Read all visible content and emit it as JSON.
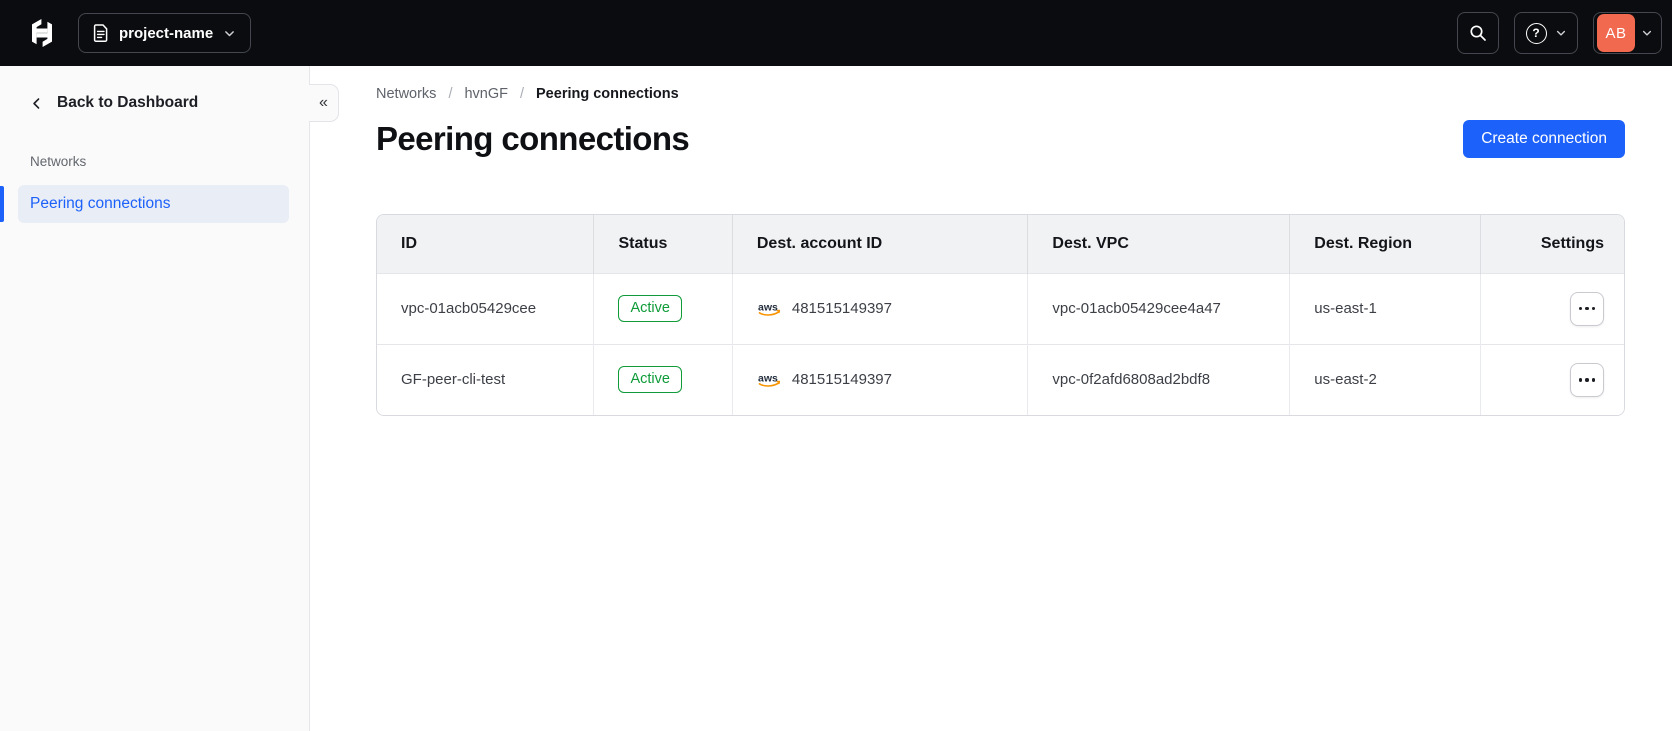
{
  "topbar": {
    "project_name": "project-name",
    "avatar_initials": "AB",
    "help_glyph": "?"
  },
  "sidebar": {
    "back_label": "Back to Dashboard",
    "section_label": "Networks",
    "active_item": "Peering connections",
    "collapse_glyph": "«"
  },
  "breadcrumb": {
    "items": [
      "Networks",
      "hvnGF",
      "Peering connections"
    ],
    "separator": "/"
  },
  "page": {
    "title": "Peering connections",
    "create_button_label": "Create connection"
  },
  "table": {
    "columns": [
      "ID",
      "Status",
      "Dest. account ID",
      "Dest. VPC",
      "Dest. Region",
      "Settings"
    ],
    "rows": [
      {
        "id": "vpc-01acb05429cee",
        "status": "Active",
        "dest_account_id": "481515149397",
        "dest_vpc": "vpc-01acb05429cee4a47",
        "dest_region": "us-east-1"
      },
      {
        "id": "GF-peer-cli-test",
        "status": "Active",
        "dest_account_id": "481515149397",
        "dest_vpc": "vpc-0f2afd6808ad2bdf8",
        "dest_region": "us-east-2"
      }
    ]
  },
  "icons": {
    "logo": "hashicorp-logo",
    "project": "document-icon",
    "search": "search-icon",
    "help": "question-circle-icon",
    "dropdowns": "chevron-down-icon",
    "back": "chevron-left-icon",
    "collapse": "double-chevron-left-icon",
    "aws": "aws-logo-icon",
    "row_menu": "ellipsis-icon"
  },
  "colors": {
    "accent_blue": "#1c61fa",
    "success_green": "#0f9b38",
    "avatar_coral": "#f1694f",
    "topbar_bg": "#0b0c0f"
  }
}
